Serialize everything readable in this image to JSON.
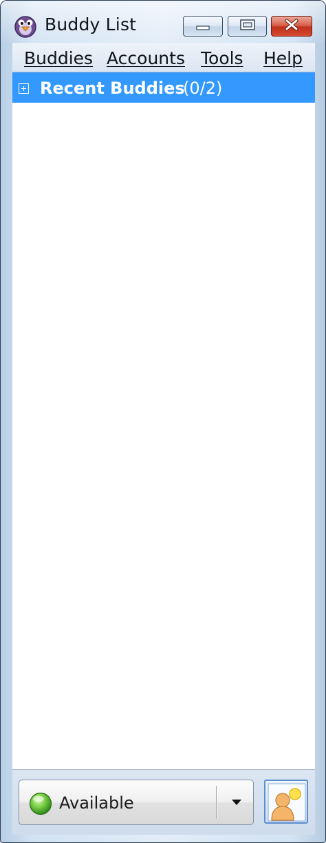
{
  "window": {
    "title": "Buddy List",
    "buttons": {
      "minimize": "minimize-icon",
      "maximize": "maximize-icon",
      "close": "close-icon"
    }
  },
  "menu": {
    "items": [
      {
        "label": "Buddies"
      },
      {
        "label": "Accounts"
      },
      {
        "label": "Tools"
      },
      {
        "label": "Help"
      }
    ]
  },
  "buddy_list": {
    "groups": [
      {
        "name": "Recent Buddies",
        "count": "(0/2)",
        "expanded": false,
        "icon": "expand-plus-icon"
      }
    ],
    "selection_color": "#3399ff"
  },
  "status": {
    "label": "Available",
    "indicator_color": "#4fb82e",
    "icon": "status-available-icon",
    "dropdown_icon": "chevron-down-icon"
  },
  "avatar": {
    "icon": "buddy-icon"
  }
}
